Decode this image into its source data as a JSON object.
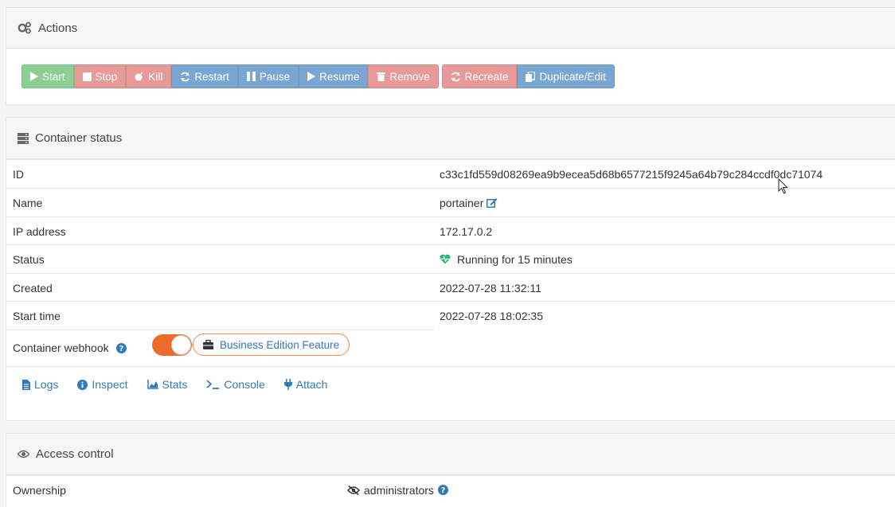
{
  "actions": {
    "title": "Actions",
    "buttons": {
      "start": "Start",
      "stop": "Stop",
      "kill": "Kill",
      "restart": "Restart",
      "pause": "Pause",
      "resume": "Resume",
      "remove": "Remove",
      "recreate": "Recreate",
      "duplicate_edit": "Duplicate/Edit"
    }
  },
  "status": {
    "title": "Container status",
    "rows": {
      "id": {
        "label": "ID",
        "value": "c33c1fd559d08269ea9b9ecea5d68b6577215f9245a64b79c284ccdf0dc71074"
      },
      "name": {
        "label": "Name",
        "value": "portainer"
      },
      "ip": {
        "label": "IP address",
        "value": "172.17.0.2"
      },
      "status": {
        "label": "Status",
        "value": "Running for 15 minutes"
      },
      "created": {
        "label": "Created",
        "value": "2022-07-28 11:32:11"
      },
      "start_time": {
        "label": "Start time",
        "value": "2022-07-28 18:02:35"
      },
      "webhook": {
        "label": "Container webhook",
        "badge": "Business Edition Feature"
      }
    },
    "links": {
      "logs": "Logs",
      "inspect": "Inspect",
      "stats": "Stats",
      "console": "Console",
      "attach": "Attach"
    }
  },
  "access": {
    "title": "Access control",
    "ownership_label": "Ownership",
    "ownership_value": "administrators"
  },
  "colors": {
    "start": "#8ccf92",
    "danger": "#e89a98",
    "primary": "#79a6d3",
    "link": "#337ab7",
    "toggle": "#ec6b2d",
    "heart": "#2bb673"
  }
}
